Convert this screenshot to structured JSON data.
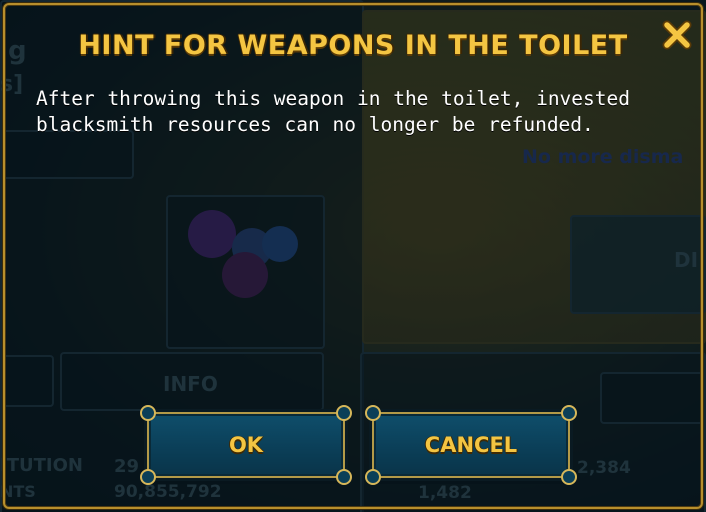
{
  "background": {
    "labels": {
      "info": "INFO",
      "left_stat_label": "ITUTION",
      "left_stat_sublabel": "NTS",
      "left_stat_value_partial": "29",
      "left_stat_value": "90,855,792",
      "right_stat_value": "1,482",
      "far_right_value": "2,384",
      "dismantle_text": "No more disma",
      "side_button_partial": "DI",
      "top_left_partial": "g",
      "top_left_bracket": "s]"
    }
  },
  "dialog": {
    "title": "HINT FOR WEAPONS IN THE TOILET",
    "message": "After throwing this weapon in the toilet, invested blacksmith resources can no longer be refunded.",
    "close_icon": "close-x-icon",
    "buttons": {
      "ok": "OK",
      "cancel": "CANCEL"
    }
  },
  "colors": {
    "title": "#f4c542",
    "button_label": "#f4c542",
    "button_fill": "#0f4f6c",
    "frame_gold": "#b88f2c",
    "message_text": "#ffffff",
    "close_icon": "#f4c542"
  }
}
